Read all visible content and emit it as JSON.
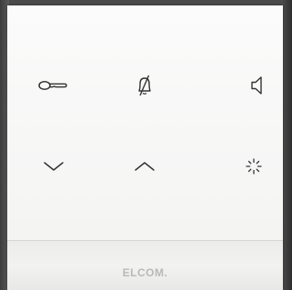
{
  "device": {
    "brand": "ELCOM.",
    "buttons": [
      {
        "id": "door-open",
        "icon": "key-icon"
      },
      {
        "id": "mute",
        "icon": "bell-muted-icon"
      },
      {
        "id": "volume",
        "icon": "speaker-icon"
      },
      {
        "id": "down",
        "icon": "chevron-down-icon"
      },
      {
        "id": "up",
        "icon": "chevron-up-icon"
      },
      {
        "id": "light",
        "icon": "light-icon"
      }
    ],
    "colors": {
      "panel": "#f7f7f6",
      "icon_stroke": "#333333",
      "brand_text": "#b9b9b6"
    }
  }
}
